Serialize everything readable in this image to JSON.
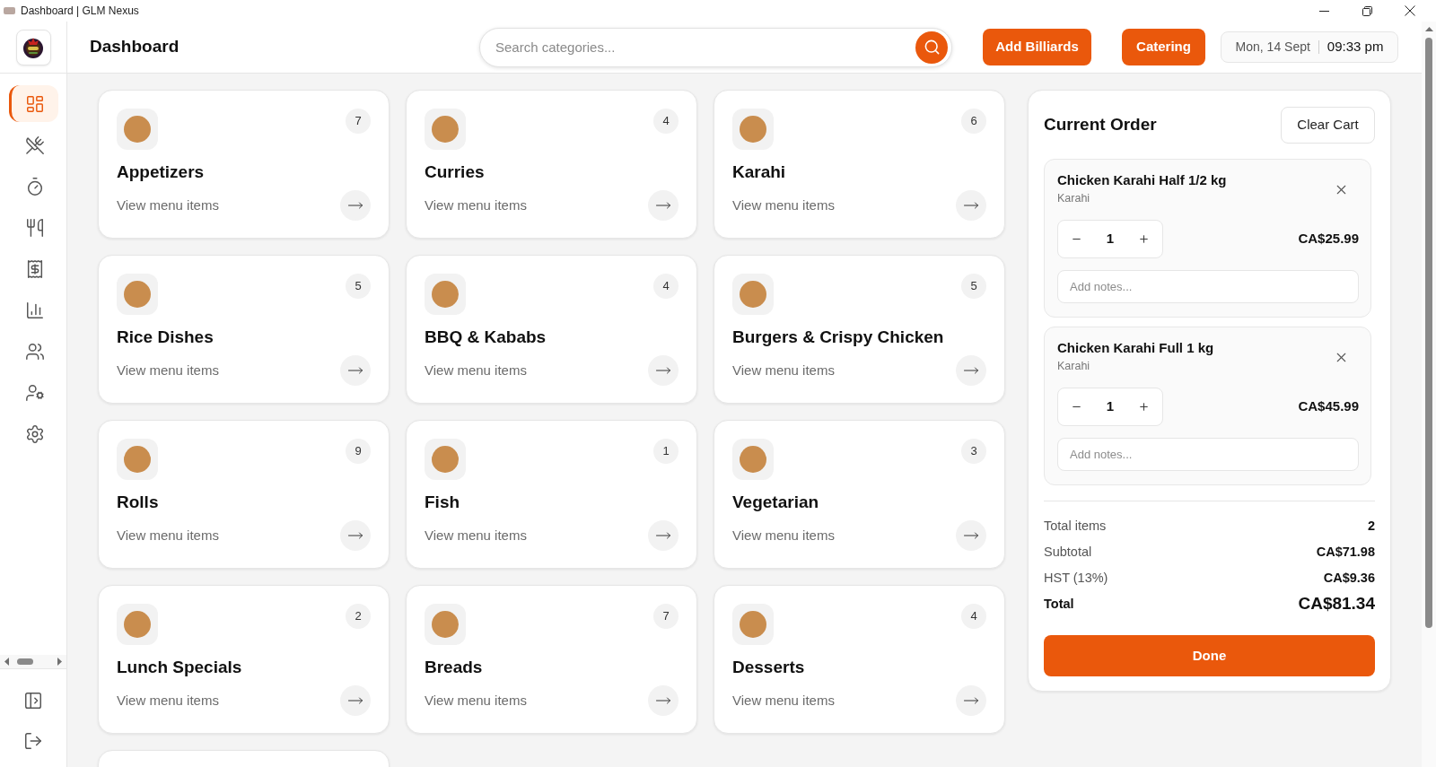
{
  "window": {
    "title": "Dashboard | GLM Nexus"
  },
  "sidebar": {
    "items": [
      {
        "selected": true
      },
      {
        "selected": false
      },
      {
        "selected": false
      },
      {
        "selected": false
      },
      {
        "selected": false
      },
      {
        "selected": false
      },
      {
        "selected": false
      },
      {
        "selected": false
      },
      {
        "selected": false
      }
    ]
  },
  "header": {
    "title": "Dashboard",
    "search": {
      "placeholder": "Search categories..."
    },
    "buttons": [
      "Add Billiards",
      "Catering"
    ],
    "date": "Mon, 14 Sept",
    "time": "09:33 pm"
  },
  "categories": [
    {
      "kind": "category",
      "name": "Appetizers",
      "count": "7",
      "link": "View menu items"
    },
    {
      "kind": "category",
      "name": "Curries",
      "count": "4",
      "link": "View menu items"
    },
    {
      "kind": "category",
      "name": "Karahi",
      "count": "6",
      "link": "View menu items"
    },
    {
      "kind": "category",
      "name": "Rice Dishes",
      "count": "5",
      "link": "View menu items"
    },
    {
      "kind": "category",
      "name": "BBQ & Kababs",
      "count": "4",
      "link": "View menu items"
    },
    {
      "kind": "category",
      "name": "Burgers & Crispy Chicken",
      "count": "5",
      "link": "View menu items"
    },
    {
      "kind": "category",
      "name": "Rolls",
      "count": "9",
      "link": "View menu items"
    },
    {
      "kind": "category",
      "name": "Fish",
      "count": "1",
      "link": "View menu items"
    },
    {
      "kind": "category",
      "name": "Vegetarian",
      "count": "3",
      "link": "View menu items"
    },
    {
      "kind": "category",
      "name": "Lunch Specials",
      "count": "2",
      "link": "View menu items"
    },
    {
      "kind": "category",
      "name": "Breads",
      "count": "7",
      "link": "View menu items"
    },
    {
      "kind": "category",
      "name": "Desserts",
      "count": "4",
      "link": "View menu items"
    },
    {
      "kind": "cut_off"
    }
  ],
  "order": {
    "title": "Current Order",
    "clear_button": "Clear Cart",
    "items": [
      {
        "name": "Chicken Karahi Half 1/2 kg",
        "category": "Karahi",
        "quantity": "1",
        "price": "CA$25.99",
        "notes": {
          "placeholder": "Add notes..."
        }
      },
      {
        "name": "Chicken Karahi Full 1 kg",
        "category": "Karahi",
        "quantity": "1",
        "price": "CA$45.99",
        "notes": {
          "placeholder": "Add notes..."
        }
      }
    ],
    "summary": [
      {
        "label": "Total items",
        "value": "2"
      },
      {
        "label": "Subtotal",
        "value": "CA$71.98"
      },
      {
        "label": "HST (13%)",
        "value": "CA$9.36"
      }
    ],
    "total": {
      "label": "Total",
      "value": "CA$81.34"
    },
    "done_button": "Done"
  }
}
